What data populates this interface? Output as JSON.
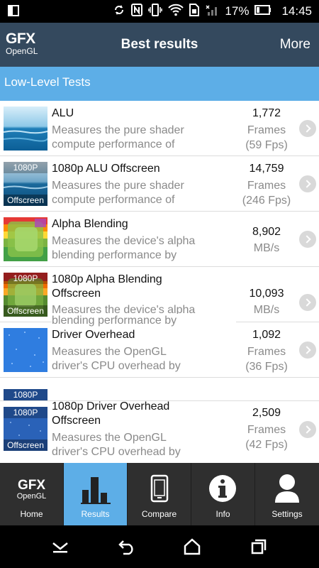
{
  "status_bar": {
    "battery_percent": "17%",
    "time": "14:45",
    "icons": [
      "screen-mirror-icon",
      "sync-icon",
      "nfc-icon",
      "vibrate-icon",
      "wifi-icon",
      "sim-icon",
      "signal-icon",
      "battery-icon"
    ]
  },
  "app_bar": {
    "logo_line1": "GFX",
    "logo_line2": "OpenGL",
    "title": "Best results",
    "more_label": "More"
  },
  "section": {
    "label": "Low-Level Tests"
  },
  "tests": [
    {
      "title": "ALU",
      "desc_line1": "Measures the pure shader",
      "desc_line2": "compute performance of",
      "value": "1,772",
      "unit_line1": "Frames",
      "unit_line2": "(59 Fps)",
      "thumb": "ocean",
      "offscreen": false
    },
    {
      "title": "1080p ALU Offscreen",
      "desc_line1": "Measures the pure shader",
      "desc_line2": "compute performance of",
      "value": "14,759",
      "unit_line1": "Frames",
      "unit_line2": "(246 Fps)",
      "thumb": "ocean",
      "offscreen": true,
      "badge_top": "1080P",
      "badge_bottom": "Offscreen"
    },
    {
      "title": "Alpha Blending",
      "desc_line1": "Measures the device's alpha",
      "desc_line2": "blending performance by",
      "value": "8,902",
      "unit_line1": "MB/s",
      "unit_line2": "",
      "thumb": "blend",
      "offscreen": false
    },
    {
      "title": "1080p Alpha Blending",
      "title_line2": "Offscreen",
      "desc_line1": "Measures the device's alpha",
      "desc_line2": "blending performance by",
      "value": "10,093",
      "unit_line1": "MB/s",
      "unit_line2": "",
      "thumb": "blend",
      "offscreen": true,
      "badge_top": "1080P",
      "badge_bottom": "Offscreen"
    },
    {
      "title": "Driver Overhead",
      "desc_line1": "Measures the OpenGL",
      "desc_line2": "driver's CPU overhead by",
      "value": "1,092",
      "unit_line1": "Frames",
      "unit_line2": "(36 Fps)",
      "thumb": "blue",
      "offscreen": false
    },
    {
      "title": "1080p Driver Overhead",
      "title_line2": "Offscreen",
      "desc_line1": "Measures the OpenGL",
      "desc_line2": "driver's CPU overhead by",
      "value": "2,509",
      "unit_line1": "Frames",
      "unit_line2": "(42 Fps)",
      "thumb": "blue",
      "offscreen": true,
      "badge_top": "1080P",
      "badge_bottom": "Offscreen"
    }
  ],
  "bottom_nav": [
    {
      "label": "Home",
      "icon": "gfx-logo-icon",
      "logo_line1": "GFX",
      "logo_line2": "OpenGL",
      "active": false
    },
    {
      "label": "Results",
      "icon": "bar-chart-icon",
      "active": true
    },
    {
      "label": "Compare",
      "icon": "phone-icon",
      "active": false
    },
    {
      "label": "Info",
      "icon": "info-icon",
      "active": false
    },
    {
      "label": "Settings",
      "icon": "user-icon",
      "active": false
    }
  ],
  "system_nav": [
    "collapse-icon",
    "back-icon",
    "home-icon",
    "recents-icon"
  ],
  "colors": {
    "app_bar": "#34495e",
    "section_header": "#5daee7",
    "active_tab": "#5daee7",
    "bottom_nav": "#2f2f2f"
  }
}
